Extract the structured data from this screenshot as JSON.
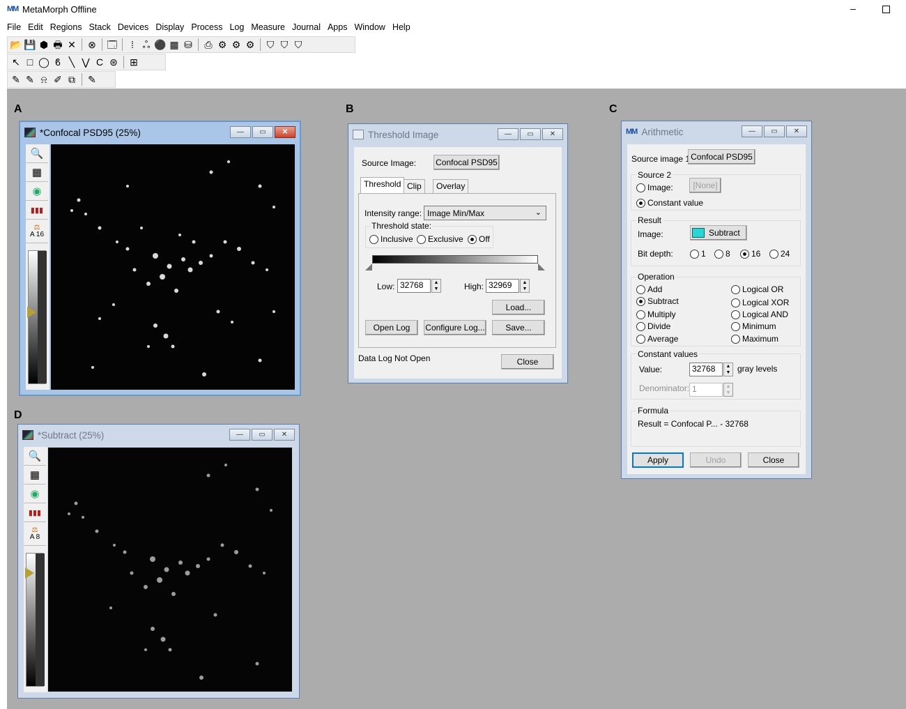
{
  "app": {
    "icon": "metamorph-logo-icon",
    "title": "MetaMorph Offline",
    "minimize": "–"
  },
  "menu": [
    "File",
    "Edit",
    "Regions",
    "Stack",
    "Devices",
    "Display",
    "Process",
    "Log",
    "Measure",
    "Journal",
    "Apps",
    "Window",
    "Help"
  ],
  "toolbar1": [
    "📂",
    "💾",
    "⬢",
    "🖶",
    "✕",
    "|",
    "⊗",
    "|",
    "🗔",
    "|",
    "⁞",
    "ஃ",
    "⚫",
    "▦",
    "⛁",
    "|",
    "⎙",
    "⚙",
    "⚙",
    "⚙",
    "|",
    "⛉",
    "⛉",
    "⛉"
  ],
  "toolbar2": [
    "↖",
    "□",
    "◯",
    "ϐ",
    "╲",
    "⋁",
    "Ϲ",
    "⊛",
    "|",
    "⊞"
  ],
  "toolbar3": [
    "✎",
    "✎",
    "⍾",
    "✐",
    "⧉",
    "|",
    "✎"
  ],
  "panels": {
    "a": "A",
    "b": "B",
    "c": "C",
    "d": "D"
  },
  "image_window_a": {
    "title": "*Confocal PSD95 (25%)",
    "tools": [
      "🔍",
      "▦",
      "◉",
      "▮▮▮"
    ],
    "scale_label": "A 16",
    "scale_symbol": "⚖",
    "controls": [
      "—",
      "▭",
      "✕"
    ]
  },
  "image_window_d": {
    "title": "*Subtract (25%)",
    "tools": [
      "🔍",
      "▦",
      "◉",
      "▮▮▮"
    ],
    "scale_label": "A 8",
    "scale_symbol": "⚖",
    "controls": [
      "—",
      "▭",
      "✕"
    ]
  },
  "threshold": {
    "title": "Threshold Image",
    "controls": [
      "—",
      "▭",
      "✕"
    ],
    "source_label": "Source Image:",
    "source_value": "Confocal PSD95",
    "tabs": [
      "Threshold",
      "Clip",
      "Overlay"
    ],
    "intensity_label": "Intensity range:",
    "intensity_value": "Image Min/Max",
    "dropdown_arrow": "⌄",
    "state_label": "Threshold state:",
    "state_options": [
      "Inclusive",
      "Exclusive",
      "Off"
    ],
    "state_selected": "Off",
    "low_label": "Low:",
    "low_value": "32768",
    "high_label": "High:",
    "high_value": "32969",
    "spin_up": "▲",
    "spin_down": "▼",
    "load": "Load...",
    "open_log": "Open Log",
    "configure_log": "Configure Log...",
    "save": "Save...",
    "status": "Data Log Not Open",
    "close": "Close"
  },
  "arithmetic": {
    "title": "Arithmetic",
    "logo": "metamorph-logo-icon",
    "controls": [
      "—",
      "▭",
      "✕"
    ],
    "source1_label": "Source image 1:",
    "source1_value": "Confocal PSD95",
    "source2_title": "Source 2",
    "source2_image": "Image:",
    "source2_image_value": "[None]",
    "source2_constant": "Constant value",
    "source2_selected": "Constant value",
    "result_title": "Result",
    "result_image_label": "Image:",
    "result_image_value": "Subtract",
    "new_image_icon": "new-image-icon",
    "bitdepth_label": "Bit depth:",
    "bitdepths": [
      "1",
      "8",
      "16",
      "24"
    ],
    "bitdepth_selected": "16",
    "operation_title": "Operation",
    "operations_left": [
      "Add",
      "Subtract",
      "Multiply",
      "Divide",
      "Average"
    ],
    "operations_right": [
      "Logical OR",
      "Logical XOR",
      "Logical AND",
      "Minimum",
      "Maximum"
    ],
    "operation_selected": "Subtract",
    "constants_title": "Constant values",
    "value_label": "Value:",
    "value": "32768",
    "value_unit": "gray levels",
    "denominator_label": "Denominator:",
    "denominator_value": "1",
    "formula_title": "Formula",
    "formula": "Result = Confocal P... - 32768",
    "apply": "Apply",
    "undo": "Undo",
    "close": "Close"
  }
}
